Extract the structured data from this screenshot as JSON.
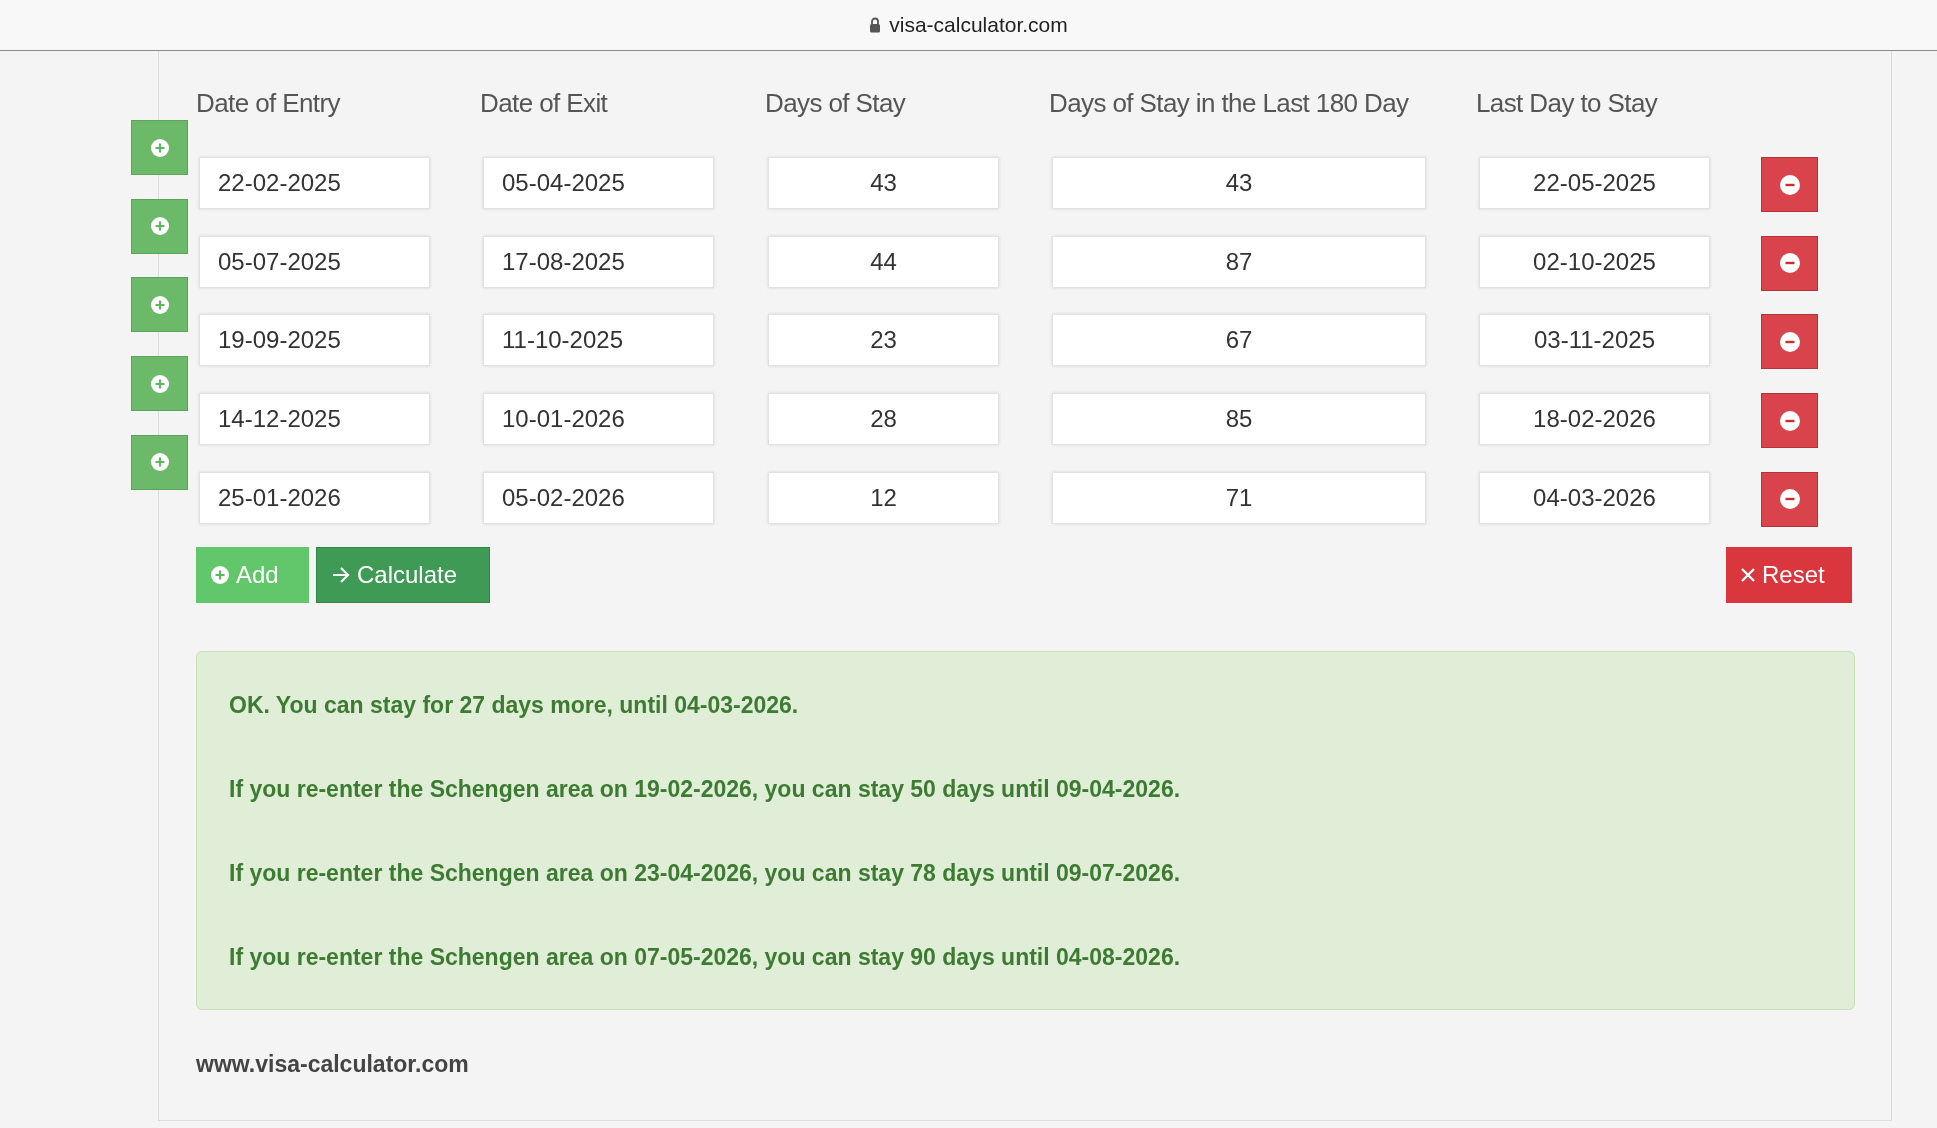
{
  "browser_bar": {
    "url": "visa-calculator.com"
  },
  "table": {
    "columns": [
      "Date of Entry",
      "Date of Exit",
      "Days of Stay",
      "Days of Stay in the Last 180 Day",
      "Last Day to Stay"
    ],
    "rows": [
      {
        "entry": "22-02-2025",
        "exit": "05-04-2025",
        "days": "43",
        "days_180": "43",
        "last_day": "22-05-2025"
      },
      {
        "entry": "05-07-2025",
        "exit": "17-08-2025",
        "days": "44",
        "days_180": "87",
        "last_day": "02-10-2025"
      },
      {
        "entry": "19-09-2025",
        "exit": "11-10-2025",
        "days": "23",
        "days_180": "67",
        "last_day": "03-11-2025"
      },
      {
        "entry": "14-12-2025",
        "exit": "10-01-2026",
        "days": "28",
        "days_180": "85",
        "last_day": "18-02-2026"
      },
      {
        "entry": "25-01-2026",
        "exit": "05-02-2026",
        "days": "12",
        "days_180": "71",
        "last_day": "04-03-2026"
      }
    ]
  },
  "actions": {
    "add": "Add",
    "calculate": "Calculate",
    "reset": "Reset"
  },
  "result": {
    "messages": [
      "OK. You can stay for 27 days more, until 04-03-2026.",
      "If you re-enter the Schengen area on 19-02-2026, you can stay 50 days until 09-04-2026.",
      "If you re-enter the Schengen area on 23-04-2026, you can stay 78 days until 09-07-2026.",
      "If you re-enter the Schengen area on 07-05-2026, you can stay 90 days until 04-08-2026."
    ]
  },
  "footer": "www.visa-calculator.com"
}
